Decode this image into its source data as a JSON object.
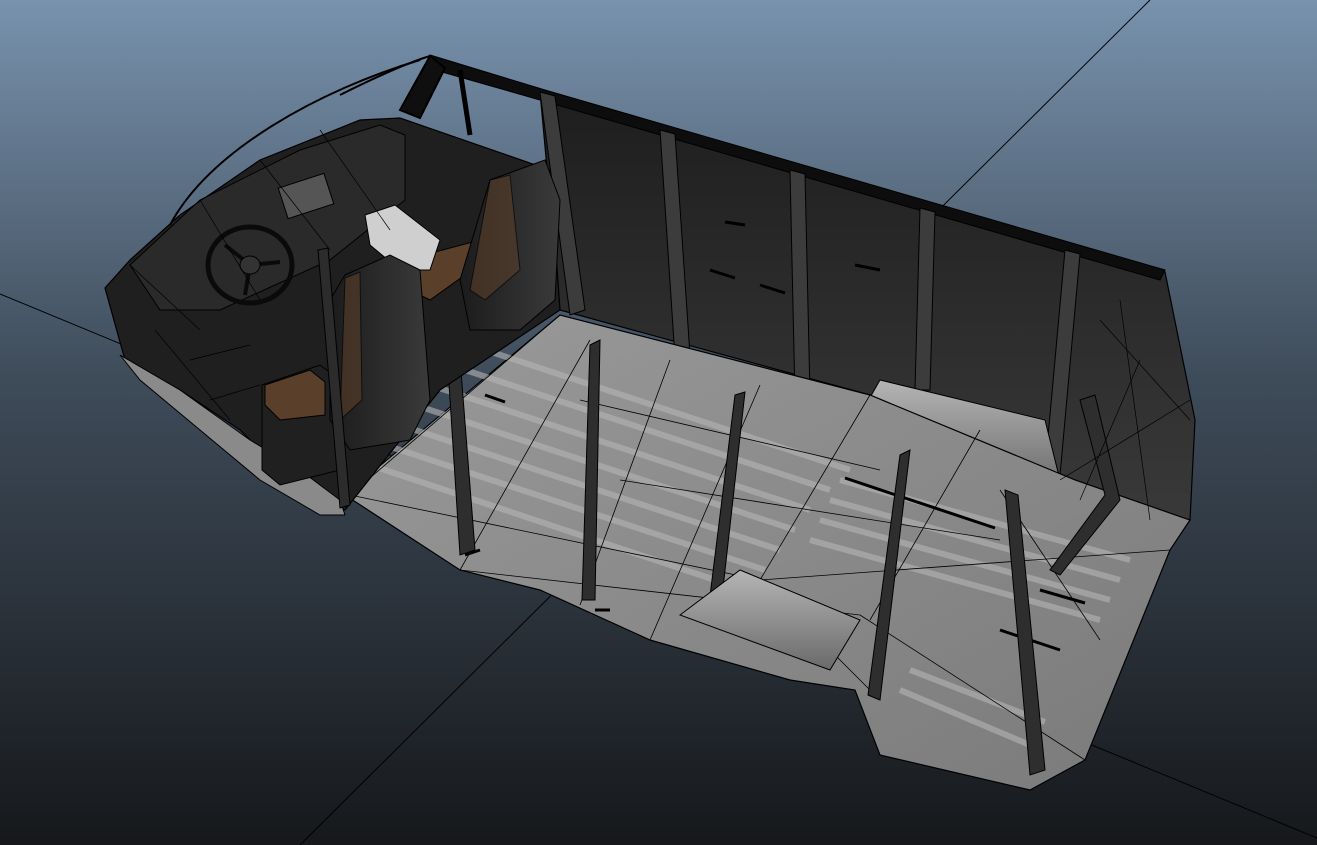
{
  "viewport": {
    "background_top": "#7892ad",
    "background_bottom": "#16181b",
    "grid_line_color": "#000000",
    "wireframe_color": "#000000"
  },
  "model": {
    "object": "van-interior-cargo-shell",
    "shading": "smooth-shaded-with-wireframe",
    "colors": {
      "floor": "#8e8e8e",
      "floor_light": "#a9a9a9",
      "floor_rib": "#b8b8b8",
      "wall": "#2b2b2b",
      "wall_dark": "#1a1a1a",
      "seat": "#262626",
      "wood": "#5a3f2a",
      "dash": "#202020"
    }
  }
}
